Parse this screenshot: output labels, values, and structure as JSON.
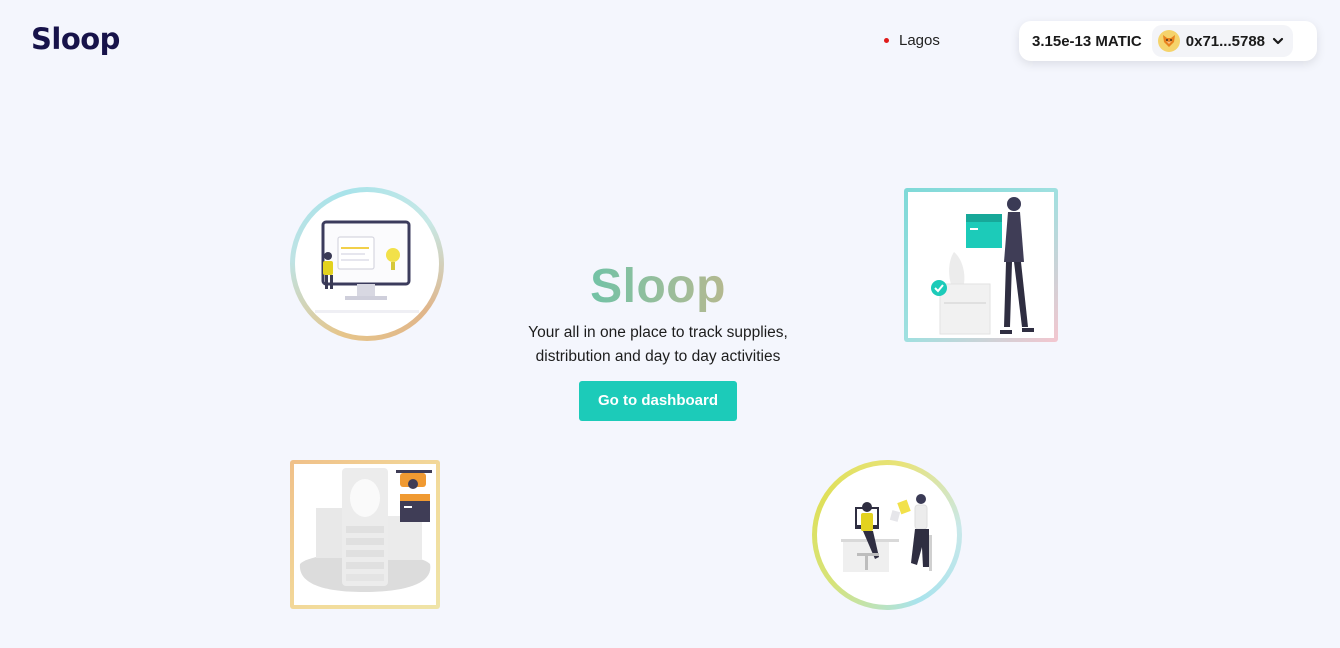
{
  "header": {
    "logo": "Sloop",
    "network": "Lagos",
    "network_color": "#e01b1b",
    "wallet": {
      "balance": "3.15e-13 MATIC",
      "address": "0x71...5788",
      "avatar_icon": "fox-avatar-icon"
    }
  },
  "hero": {
    "title": "Sloop",
    "subtitle_line1": "Your all in one place to track supplies,",
    "subtitle_line2": "distribution and day to day activities",
    "cta_label": "Go to dashboard"
  },
  "colors": {
    "background": "#f4f6fd",
    "brand_dark": "#17134a",
    "accent": "#1ccbb9"
  },
  "illustrations": [
    "monitor-person-illustration",
    "delivery-box-person-illustration",
    "drone-delivery-illustration",
    "office-team-illustration"
  ]
}
